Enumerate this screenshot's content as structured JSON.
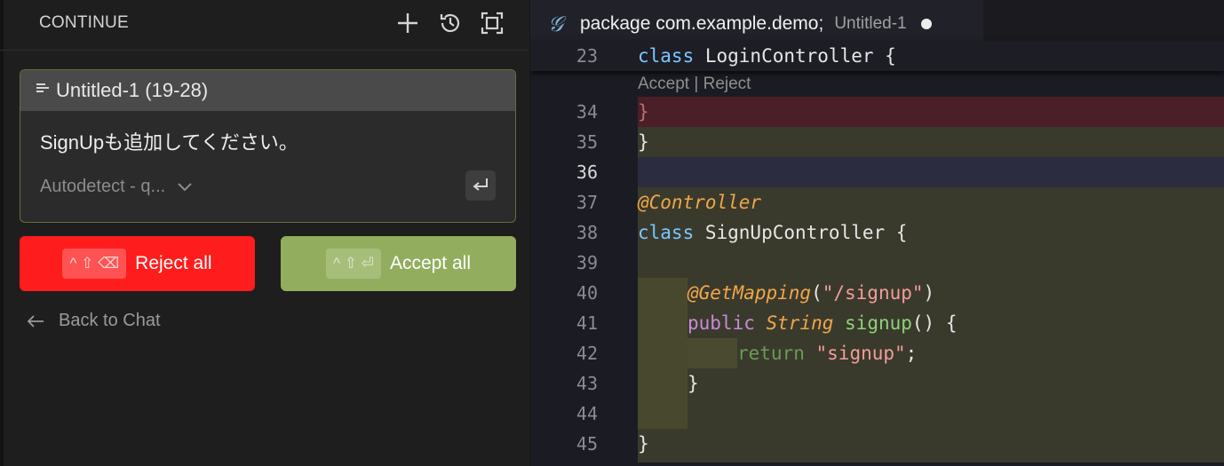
{
  "sidebar": {
    "title": "CONTINUE",
    "icons": [
      "plus-icon",
      "history-icon",
      "fullscreen-icon"
    ]
  },
  "chat": {
    "context_label": "Untitled-1 (19-28)",
    "prompt": "SignUpも追加してください。",
    "model_selector": "Autodetect - q..."
  },
  "actions": {
    "reject_shortcut": "^ ⇧ ⌫",
    "reject_label": "Reject all",
    "accept_shortcut": "^ ⇧ ⏎",
    "accept_label": "Accept all",
    "back_label": "Back to Chat"
  },
  "editor": {
    "tab_title": "package com.example.demo;",
    "tab_subtitle": "Untitled-1",
    "codelens_accept": "Accept",
    "codelens_sep": " | ",
    "codelens_reject": "Reject",
    "ln23": "23",
    "ln34": "34",
    "ln35": "35",
    "ln36": "36",
    "ln37": "37",
    "ln38": "38",
    "ln39": "39",
    "ln40": "40",
    "ln41": "41",
    "ln42": "42",
    "ln43": "43",
    "ln44": "44",
    "ln45": "45",
    "c23_kw": "class",
    "c23_name": " LoginController {",
    "c34": "}",
    "c35": "}",
    "c37": "@Controller",
    "c38_kw": "class",
    "c38_name": " SignUpController {",
    "c40_ann": "@GetMapping",
    "c40_open": "(",
    "c40_str": "\"/signup\"",
    "c40_close": ")",
    "c41_kw": "public",
    "c41_type": "String",
    "c41_fn": "signup",
    "c41_rest": "() {",
    "c42_kw": "return",
    "c42_str": "\"signup\"",
    "c42_semi": ";",
    "c43": "}",
    "c45": "}"
  },
  "colors": {
    "reject": "#ff1c1c",
    "accept": "#92ad5e",
    "removed_line": "#4a1f27",
    "added_line": "#3a3a2c",
    "current_line": "#2c2c40"
  }
}
